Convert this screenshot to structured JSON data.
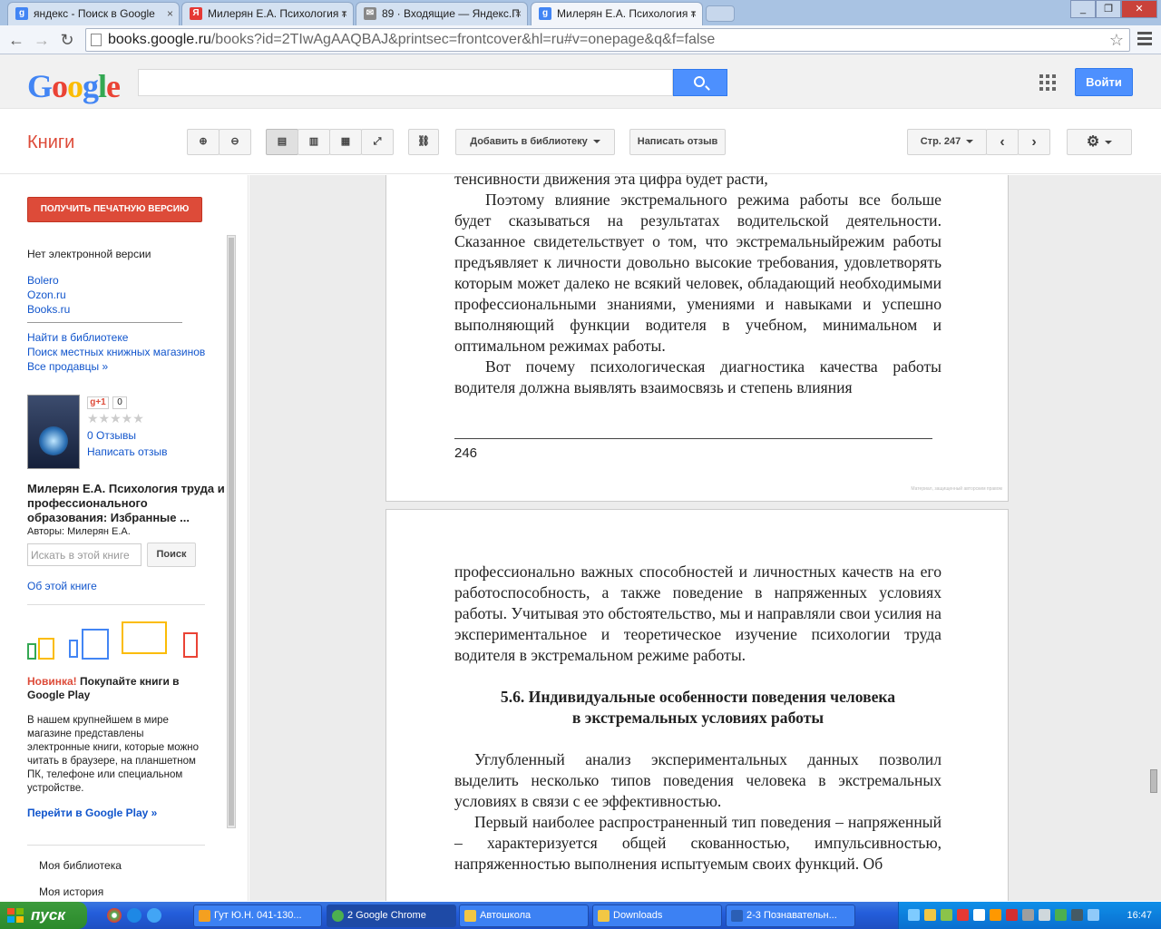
{
  "browser": {
    "tabs": [
      {
        "title": "яндекс - Поиск в Google",
        "favicon": "g"
      },
      {
        "title": "Милерян Е.А. Психология т",
        "favicon": "Я"
      },
      {
        "title": "89 · Входящие — Яндекс.П",
        "favicon": "✉"
      },
      {
        "title": "Милерян Е.А. Психология т",
        "favicon": "g"
      }
    ],
    "url_host": "books.google.ru",
    "url_rest": "/books?id=2TIwAgAAQBAJ&printsec=frontcover&hl=ru#v=onepage&q&f=false"
  },
  "google_header": {
    "logo": "Google",
    "search_value": "",
    "signin_label": "Войти"
  },
  "books_toolbar": {
    "title": "Книги",
    "add_to_library": "Добавить в библиотеку",
    "write_review": "Написать отзыв",
    "page_label": "Стр. 247"
  },
  "left_panel": {
    "print_button": "ПОЛУЧИТЬ ПЕЧАТНУЮ ВЕРСИЮ",
    "no_ebook": "Нет электронной версии",
    "sellers": [
      "Bolero",
      "Ozon.ru",
      "Books.ru"
    ],
    "find_library": "Найти в библиотеке",
    "local_stores": "Поиск местных книжных магазинов",
    "all_sellers": "Все продавцы »",
    "gplus": "g+1",
    "gplus_count": "0",
    "rating_stars": 0,
    "reviews_count": "0 Отзывы",
    "write_review": "Написать отзыв",
    "book_title": "Милерян Е.А. Психология труда и профессионального образования: Избранные ...",
    "authors": "Авторы: Милерян Е.А.",
    "search_placeholder": "Искать в этой книге",
    "search_button": "Поиск",
    "about_book": "Об этой книге",
    "promo_new": "Новинка!",
    "promo_title": " Покупайте книги в Google Play",
    "promo_text": "В нашем крупнейшем в мире магазине представлены электронные книги, которые можно читать в браузере, на планшетном ПК, телефоне или специальном устройстве.",
    "promo_link": "Перейти в Google Play »",
    "my_library": "Моя библиотека",
    "my_history": "Моя история"
  },
  "reader": {
    "page1": {
      "top_line": "тенсивности движения эта цифра будет расти,",
      "para1": "Поэтому влияние экстремального режима работы все больше будет сказываться на результатах водительской деятельности. Сказанное свидетельствует о том, что экстремальныйрежим работы предъявляет к личности довольно высокие требования, удовлетворять которым может далеко не всякий человек, обладающий необходимыми профессиональными знаниями, умениями и навыками и успешно выполняющий функции водителя в учебном, минимальном и оптимальном режимах работы.",
      "para2": "Вот почему психологическая диагностика качества работы водителя должна выявлять взаимосвязь и степень влияния",
      "page_number": "246",
      "watermark": "Материал, защищенный авторским правом"
    },
    "page2": {
      "para1": "профессионально важных способностей и личностных качеств на его работоспособность, а также поведение в напряженных условиях работы. Учитывая это обстоятельство, мы и направляли свои усилия на экспериментальное и теоретическое изучение психологии труда водителя в экстремальном режиме работы.",
      "heading1": "5.6. Индивидуальные особенности поведения человека",
      "heading2": "в экстремальных условиях работы",
      "para2": "Углубленный анализ экспериментальных данных позволил выделить несколько типов поведения человека в экстремальных условиях в связи с ее эффективностью.",
      "para3": "Первый наиболее распространенный тип поведения – напряженный – характеризуется общей скованностью, импульсивностью, напряженностью выполнения испытуемым своих функций. Об"
    }
  },
  "taskbar": {
    "start": "пуск",
    "items": [
      {
        "label": "Гут Ю.Н. 041-130...",
        "icon_color": "#f4a020"
      },
      {
        "label": "2 Google Chrome",
        "icon_color": "#4caf50"
      },
      {
        "label": "Автошкола",
        "icon_color": "#f2c744"
      },
      {
        "label": "Downloads",
        "icon_color": "#f2c744"
      },
      {
        "label": "2-3 Познавательн...",
        "icon_color": "#2b5fb5"
      }
    ],
    "clock": "16:47"
  }
}
